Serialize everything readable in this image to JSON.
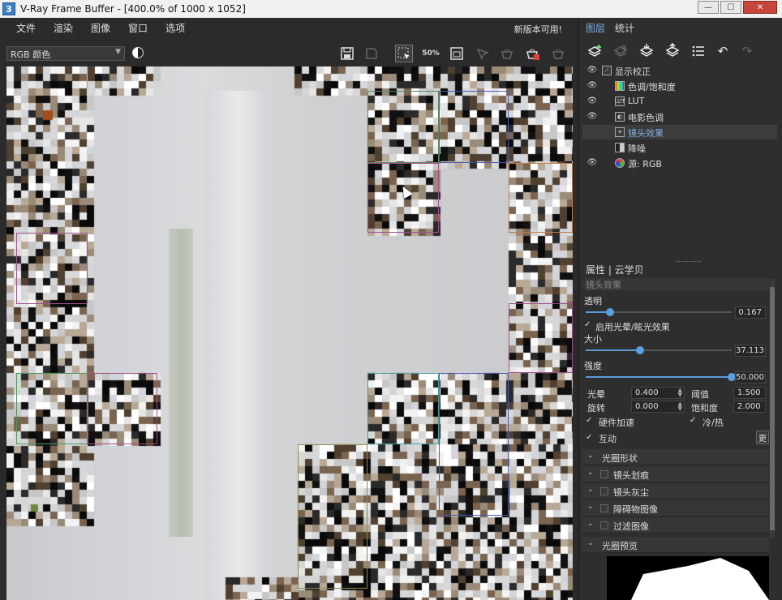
{
  "window": {
    "app_icon": "3",
    "title": "V-Ray Frame Buffer - [400.0% of 1000 x 1052]",
    "buttons": [
      "minimize",
      "maximize",
      "close"
    ]
  },
  "menu": {
    "items": [
      "文件",
      "渲染",
      "图像",
      "窗口",
      "选项"
    ],
    "update_notice": "新版本可用!"
  },
  "toolbar": {
    "channel_value": "RGB 颜色",
    "zoom_label": "50%",
    "icons": [
      "save-icon",
      "save-all-icon",
      "region-select-icon",
      "zoom-50-icon",
      "fit-view-icon",
      "track-mouse-icon",
      "bucket-icon",
      "stop-render-icon",
      "clear-icon"
    ]
  },
  "right_tabs": [
    "图层",
    "统计"
  ],
  "layer_toolbar_icons": [
    "add-layer-icon",
    "remove-layer-icon",
    "save-layers-icon",
    "load-layers-icon",
    "list-menu-icon",
    "undo-icon",
    "redo-icon"
  ],
  "layers": [
    {
      "label": "显示校正",
      "eye": true,
      "icon": "display-correction-icon"
    },
    {
      "label": "色调/饱和度",
      "eye": true,
      "icon": "hue-saturation-icon"
    },
    {
      "label": "LUT",
      "eye": true,
      "icon": "lut-icon",
      "icon_text": "LUT"
    },
    {
      "label": "电影色调",
      "eye": true,
      "icon": "filmic-icon"
    },
    {
      "label": "镜头效果",
      "eye": false,
      "icon": "lens-effects-icon",
      "selected": true
    },
    {
      "label": "降噪",
      "eye": false,
      "icon": "denoise-icon"
    },
    {
      "label": "源: RGB",
      "eye": true,
      "icon": "source-rgb-icon"
    }
  ],
  "properties": {
    "header": "属性 | 云学贝",
    "sub_header": "镜头效果",
    "opacity_label": "透明",
    "opacity_value": "0.167",
    "opacity_fraction": 0.167,
    "enable_bloom_label": "启用光晕/眩光效果",
    "size_label": "大小",
    "size_value": "37.113",
    "size_fraction": 0.37,
    "intensity_label": "强度",
    "intensity_value": "50.000",
    "intensity_fraction": 1.0,
    "bloom_label": "光晕",
    "bloom_value": "0.400",
    "threshold_label": "阈值",
    "threshold_value": "1.500",
    "rotation_label": "旋转",
    "rotation_value": "0.000",
    "saturation_label": "饱和度",
    "saturation_value": "2.000",
    "hw_accel_label": "硬件加速",
    "cold_hot_label": "冷/热",
    "interactive_label": "互动",
    "update_button": "更"
  },
  "sections": [
    {
      "label": "光圈形状",
      "checkbox": false
    },
    {
      "label": "镜头划痕",
      "checkbox": true
    },
    {
      "label": "镜头灰尘",
      "checkbox": true
    },
    {
      "label": "障碍物图像",
      "checkbox": true
    },
    {
      "label": "过滤图像",
      "checkbox": true
    },
    {
      "label": "光圈预览",
      "checkbox": false
    }
  ],
  "colors": {
    "accent": "#5aa0e0",
    "selected_tab": "#7fb0e8",
    "panel_bg": "#2e2e2e",
    "close_button": "#c7463b"
  }
}
